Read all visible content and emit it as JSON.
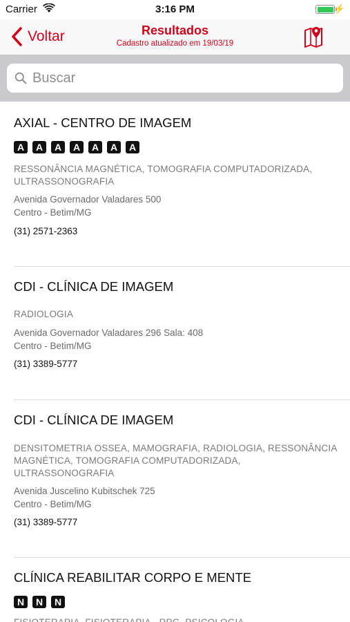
{
  "status_bar": {
    "carrier": "Carrier",
    "time": "3:16 PM",
    "battery_level": 1.0
  },
  "nav": {
    "back_label": "Voltar",
    "title": "Resultados",
    "subtitle": "Cadastro atualizado em 19/03/19",
    "accent_color": "#d0021b",
    "map_icon": "map-pin-icon"
  },
  "search": {
    "placeholder": "Buscar",
    "value": ""
  },
  "results": [
    {
      "name": "AXIAL - CENTRO DE IMAGEM",
      "badges": [
        "A",
        "A",
        "A",
        "A",
        "A",
        "A",
        "A"
      ],
      "services": "RESSONÂNCIA MAGNÉTICA, TOMOGRAFIA COMPUTADORIZADA, ULTRASSONOGRAFIA",
      "address_line1": "Avenida Governador Valadares 500",
      "address_line2": "Centro - Betim/MG",
      "phone": "(31) 2571-2363"
    },
    {
      "name": "CDI - CLÍNICA DE IMAGEM",
      "badges": [],
      "services": "RADIOLOGIA",
      "address_line1": "Avenida Governador Valadares 296 Sala: 408",
      "address_line2": "Centro - Betim/MG",
      "phone": "(31) 3389-5777"
    },
    {
      "name": "CDI - CLÍNICA DE IMAGEM",
      "badges": [],
      "services": "DENSITOMETRIA OSSEA, MAMOGRAFIA, RADIOLOGIA, RESSONÂNCIA MAGNÉTICA, TOMOGRAFIA COMPUTADORIZADA, ULTRASSONOGRAFIA",
      "address_line1": "Avenida Juscelino Kubitschek 725",
      "address_line2": "Centro - Betim/MG",
      "phone": "(31) 3389-5777"
    },
    {
      "name": "CLÍNICA REABILITAR CORPO E MENTE",
      "badges": [
        "N",
        "N",
        "N"
      ],
      "services": "FISIOTERAPIA, FISIOTERAPIA - RPG, PSICOLOGIA",
      "address_line1": "",
      "address_line2": "",
      "phone": ""
    }
  ]
}
